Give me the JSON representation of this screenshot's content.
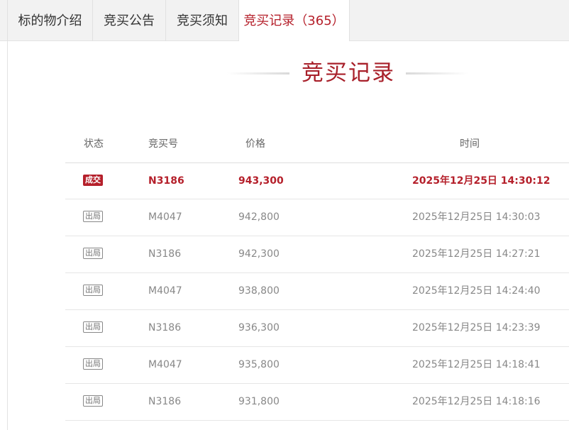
{
  "tabs": [
    {
      "label": "标的物介绍"
    },
    {
      "label": "竞买公告"
    },
    {
      "label": "竞买须知"
    },
    {
      "label": "竞买记录（365）"
    }
  ],
  "section_title": "竞买记录",
  "table": {
    "headers": {
      "status": "状态",
      "bid_no": "竞买号",
      "price": "价格",
      "time": "时间"
    },
    "rows": [
      {
        "status": "成交",
        "bid_no": "N3186",
        "price": "943,300",
        "time": "2025年12月25日 14:30:12"
      },
      {
        "status": "出局",
        "bid_no": "M4047",
        "price": "942,800",
        "time": "2025年12月25日 14:30:03"
      },
      {
        "status": "出局",
        "bid_no": "N3186",
        "price": "942,300",
        "time": "2025年12月25日 14:27:21"
      },
      {
        "status": "出局",
        "bid_no": "M4047",
        "price": "938,800",
        "time": "2025年12月25日 14:24:40"
      },
      {
        "status": "出局",
        "bid_no": "N3186",
        "price": "936,300",
        "time": "2025年12月25日 14:23:39"
      },
      {
        "status": "出局",
        "bid_no": "M4047",
        "price": "935,800",
        "time": "2025年12月25日 14:18:41"
      },
      {
        "status": "出局",
        "bid_no": "N3186",
        "price": "931,800",
        "time": "2025年12月25日 14:18:16"
      }
    ]
  },
  "colors": {
    "accent": "#b5202b",
    "text": "#333333",
    "muted": "#888888",
    "tab_bg": "#f2f2f2"
  }
}
